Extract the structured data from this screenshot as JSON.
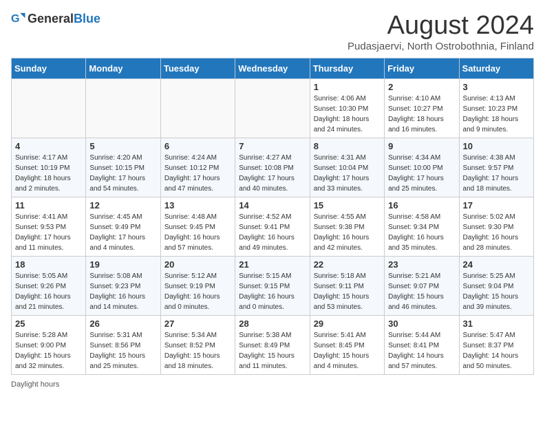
{
  "header": {
    "logo_general": "General",
    "logo_blue": "Blue",
    "main_title": "August 2024",
    "subtitle": "Pudasjaervi, North Ostrobothnia, Finland"
  },
  "columns": [
    "Sunday",
    "Monday",
    "Tuesday",
    "Wednesday",
    "Thursday",
    "Friday",
    "Saturday"
  ],
  "weeks": [
    [
      {
        "day": "",
        "info": ""
      },
      {
        "day": "",
        "info": ""
      },
      {
        "day": "",
        "info": ""
      },
      {
        "day": "",
        "info": ""
      },
      {
        "day": "1",
        "info": "Sunrise: 4:06 AM\nSunset: 10:30 PM\nDaylight: 18 hours and 24 minutes."
      },
      {
        "day": "2",
        "info": "Sunrise: 4:10 AM\nSunset: 10:27 PM\nDaylight: 18 hours and 16 minutes."
      },
      {
        "day": "3",
        "info": "Sunrise: 4:13 AM\nSunset: 10:23 PM\nDaylight: 18 hours and 9 minutes."
      }
    ],
    [
      {
        "day": "4",
        "info": "Sunrise: 4:17 AM\nSunset: 10:19 PM\nDaylight: 18 hours and 2 minutes."
      },
      {
        "day": "5",
        "info": "Sunrise: 4:20 AM\nSunset: 10:15 PM\nDaylight: 17 hours and 54 minutes."
      },
      {
        "day": "6",
        "info": "Sunrise: 4:24 AM\nSunset: 10:12 PM\nDaylight: 17 hours and 47 minutes."
      },
      {
        "day": "7",
        "info": "Sunrise: 4:27 AM\nSunset: 10:08 PM\nDaylight: 17 hours and 40 minutes."
      },
      {
        "day": "8",
        "info": "Sunrise: 4:31 AM\nSunset: 10:04 PM\nDaylight: 17 hours and 33 minutes."
      },
      {
        "day": "9",
        "info": "Sunrise: 4:34 AM\nSunset: 10:00 PM\nDaylight: 17 hours and 25 minutes."
      },
      {
        "day": "10",
        "info": "Sunrise: 4:38 AM\nSunset: 9:57 PM\nDaylight: 17 hours and 18 minutes."
      }
    ],
    [
      {
        "day": "11",
        "info": "Sunrise: 4:41 AM\nSunset: 9:53 PM\nDaylight: 17 hours and 11 minutes."
      },
      {
        "day": "12",
        "info": "Sunrise: 4:45 AM\nSunset: 9:49 PM\nDaylight: 17 hours and 4 minutes."
      },
      {
        "day": "13",
        "info": "Sunrise: 4:48 AM\nSunset: 9:45 PM\nDaylight: 16 hours and 57 minutes."
      },
      {
        "day": "14",
        "info": "Sunrise: 4:52 AM\nSunset: 9:41 PM\nDaylight: 16 hours and 49 minutes."
      },
      {
        "day": "15",
        "info": "Sunrise: 4:55 AM\nSunset: 9:38 PM\nDaylight: 16 hours and 42 minutes."
      },
      {
        "day": "16",
        "info": "Sunrise: 4:58 AM\nSunset: 9:34 PM\nDaylight: 16 hours and 35 minutes."
      },
      {
        "day": "17",
        "info": "Sunrise: 5:02 AM\nSunset: 9:30 PM\nDaylight: 16 hours and 28 minutes."
      }
    ],
    [
      {
        "day": "18",
        "info": "Sunrise: 5:05 AM\nSunset: 9:26 PM\nDaylight: 16 hours and 21 minutes."
      },
      {
        "day": "19",
        "info": "Sunrise: 5:08 AM\nSunset: 9:23 PM\nDaylight: 16 hours and 14 minutes."
      },
      {
        "day": "20",
        "info": "Sunrise: 5:12 AM\nSunset: 9:19 PM\nDaylight: 16 hours and 0 minutes."
      },
      {
        "day": "21",
        "info": "Sunrise: 5:15 AM\nSunset: 9:15 PM\nDaylight: 16 hours and 0 minutes."
      },
      {
        "day": "22",
        "info": "Sunrise: 5:18 AM\nSunset: 9:11 PM\nDaylight: 15 hours and 53 minutes."
      },
      {
        "day": "23",
        "info": "Sunrise: 5:21 AM\nSunset: 9:07 PM\nDaylight: 15 hours and 46 minutes."
      },
      {
        "day": "24",
        "info": "Sunrise: 5:25 AM\nSunset: 9:04 PM\nDaylight: 15 hours and 39 minutes."
      }
    ],
    [
      {
        "day": "25",
        "info": "Sunrise: 5:28 AM\nSunset: 9:00 PM\nDaylight: 15 hours and 32 minutes."
      },
      {
        "day": "26",
        "info": "Sunrise: 5:31 AM\nSunset: 8:56 PM\nDaylight: 15 hours and 25 minutes."
      },
      {
        "day": "27",
        "info": "Sunrise: 5:34 AM\nSunset: 8:52 PM\nDaylight: 15 hours and 18 minutes."
      },
      {
        "day": "28",
        "info": "Sunrise: 5:38 AM\nSunset: 8:49 PM\nDaylight: 15 hours and 11 minutes."
      },
      {
        "day": "29",
        "info": "Sunrise: 5:41 AM\nSunset: 8:45 PM\nDaylight: 15 hours and 4 minutes."
      },
      {
        "day": "30",
        "info": "Sunrise: 5:44 AM\nSunset: 8:41 PM\nDaylight: 14 hours and 57 minutes."
      },
      {
        "day": "31",
        "info": "Sunrise: 5:47 AM\nSunset: 8:37 PM\nDaylight: 14 hours and 50 minutes."
      }
    ]
  ],
  "footer": {
    "daylight_label": "Daylight hours"
  }
}
